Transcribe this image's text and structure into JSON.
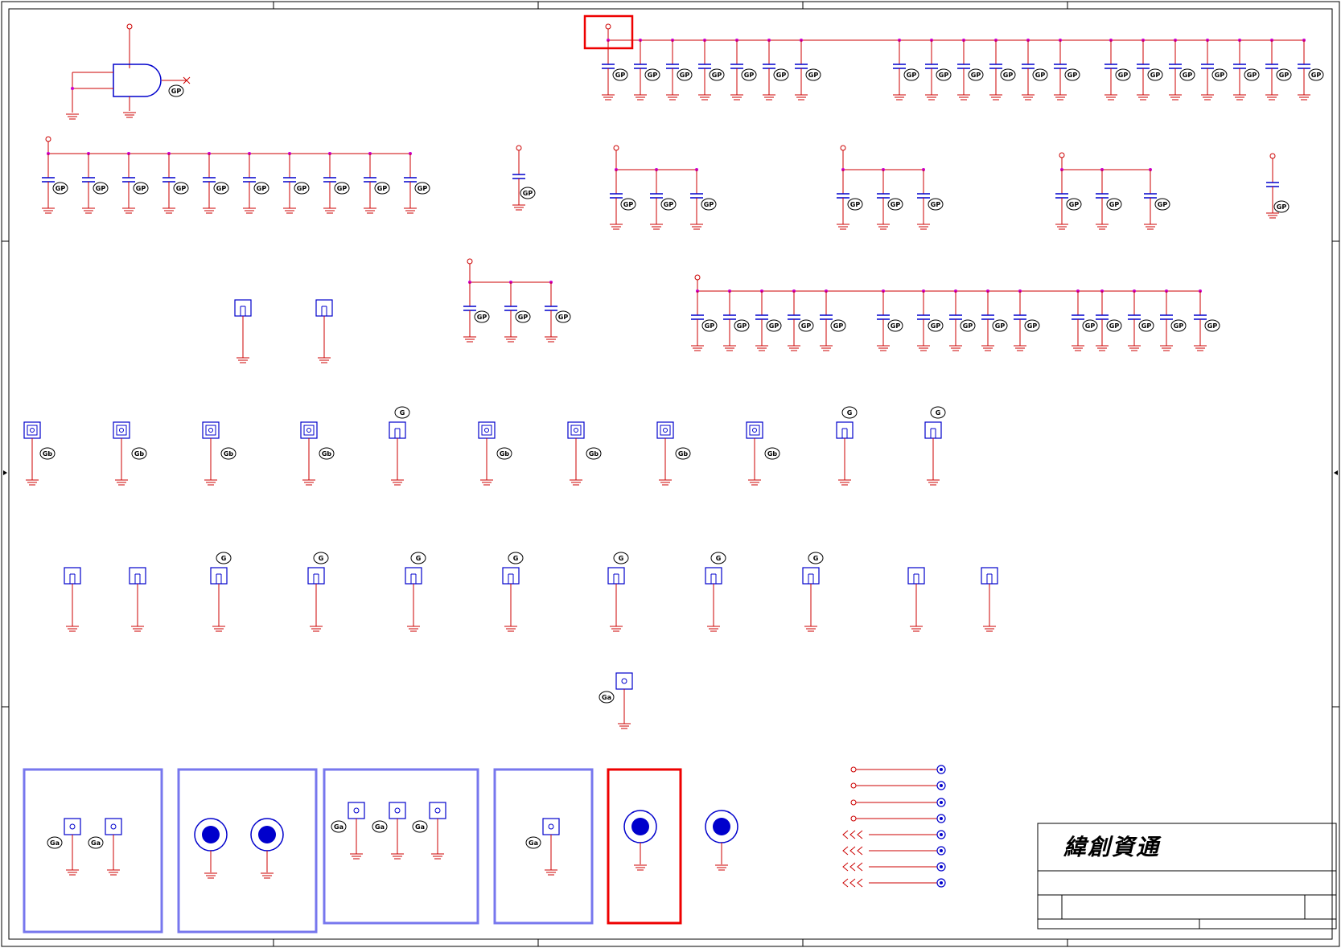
{
  "title_block": {
    "company": "緯創資通"
  },
  "colors": {
    "wire": "#cc0000",
    "component": "#0000cc",
    "junction": "#cc00cc",
    "frame": "#000000",
    "group_box": "#7777ee",
    "highlight": "#ee0000",
    "label": "#000000"
  },
  "labels": {
    "gate": "GP",
    "cap": "GP",
    "pad_a": "Gb",
    "pad_b": "G",
    "pad_c": "Ga"
  },
  "icons": [
    "and-gate-icon",
    "capacitor-icon",
    "ground-icon",
    "test-pad-icon",
    "mounting-hole-icon",
    "off-page-connector-icon"
  ]
}
